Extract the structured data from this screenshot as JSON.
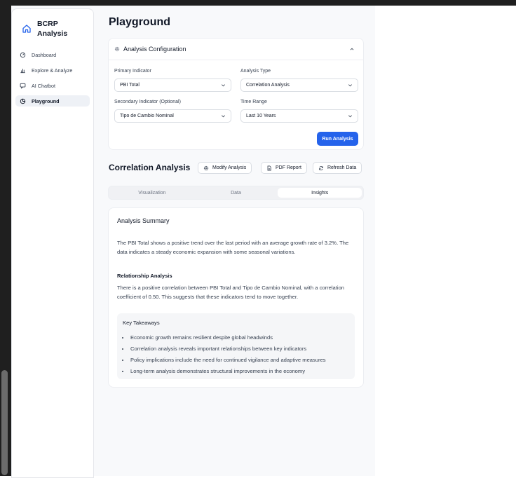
{
  "brand": {
    "line1": "BCRP",
    "line2": "Analysis"
  },
  "nav": [
    {
      "label": "Dashboard",
      "icon": "dashboard-icon",
      "active": false
    },
    {
      "label": "Explore & Analyze",
      "icon": "bar-chart-icon",
      "active": false
    },
    {
      "label": "AI Chatbot",
      "icon": "chat-icon",
      "active": false
    },
    {
      "label": "Playground",
      "icon": "playground-icon",
      "active": true
    }
  ],
  "page": {
    "title": "Playground"
  },
  "config": {
    "title": "Analysis Configuration",
    "primary_label": "Primary Indicator",
    "primary_value": "PBI Total",
    "analysis_type_label": "Analysis Type",
    "analysis_type_value": "Correlation Analysis",
    "secondary_label": "Secondary Indicator (Optional)",
    "secondary_value": "Tipo de Cambio Nominal",
    "time_range_label": "Time Range",
    "time_range_value": "Last 10 Years",
    "run_label": "Run Analysis"
  },
  "results": {
    "title": "Correlation Analysis",
    "modify_label": "Modify Analysis",
    "pdf_label": "PDF Report",
    "refresh_label": "Refresh Data"
  },
  "tabs": [
    {
      "label": "Visualization",
      "active": false
    },
    {
      "label": "Data",
      "active": false
    },
    {
      "label": "Insights",
      "active": true
    }
  ],
  "summary": {
    "heading": "Analysis Summary",
    "text": "The PBI Total shows a positive trend over the last period with an average growth rate of 3.2%. The data indicates a steady economic expansion with some seasonal variations.",
    "relationship_heading": "Relationship Analysis",
    "relationship_text": "There is a positive correlation between PBI Total and Tipo de Cambio Nominal, with a correlation coefficient of 0.50. This suggests that these indicators tend to move together.",
    "takeaways_heading": "Key Takeaways",
    "takeaways": [
      "Economic growth remains resilient despite global headwinds",
      "Correlation analysis reveals important relationships between key indicators",
      "Policy implications include the need for continued vigilance and adaptive measures",
      "Long-term analysis demonstrates structural improvements in the economy"
    ]
  },
  "colors": {
    "accent": "#2563eb",
    "sidebar_active": "#eef1f6",
    "page_bg": "#f8f9fb"
  }
}
